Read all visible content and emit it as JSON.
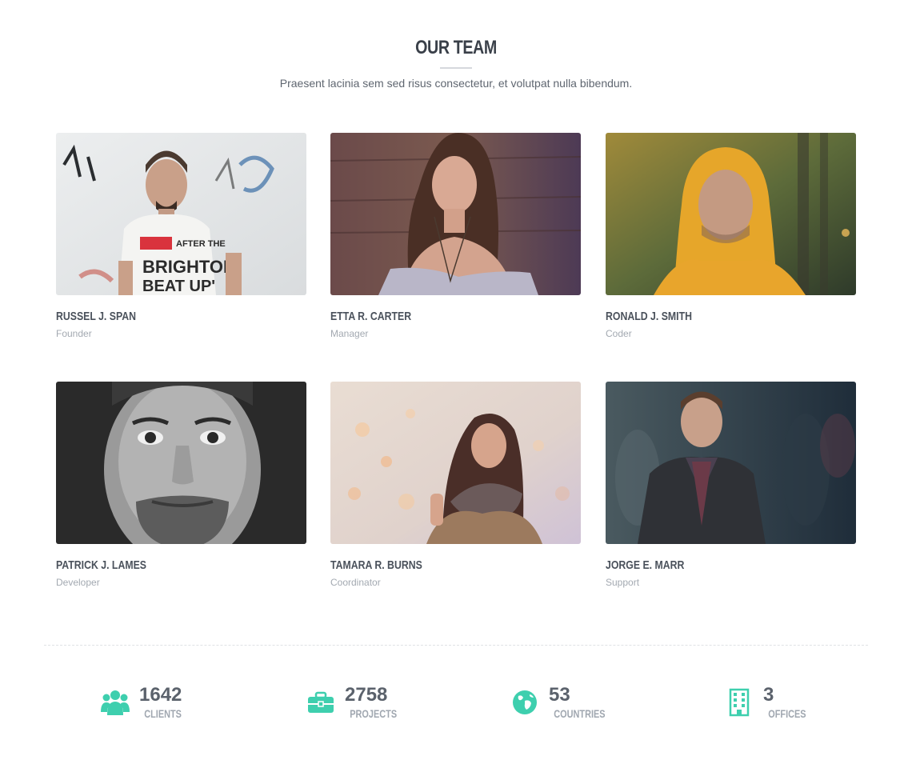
{
  "section": {
    "title": "OUR TEAM",
    "subtitle": "Praesent lacinia sem sed risus consectetur, et volutpat nulla bibendum."
  },
  "team": [
    {
      "name": "RUSSEL J. SPAN",
      "role": "Founder"
    },
    {
      "name": "ETTA R. CARTER",
      "role": "Manager"
    },
    {
      "name": "RONALD J. SMITH",
      "role": "Coder"
    },
    {
      "name": "PATRICK J. LAMES",
      "role": "Developer"
    },
    {
      "name": "TAMARA R. BURNS",
      "role": "Coordinator"
    },
    {
      "name": "JORGE E. MARR",
      "role": "Support"
    }
  ],
  "stats": [
    {
      "value": "1642",
      "label": "CLIENTS",
      "icon": "users-icon"
    },
    {
      "value": "2758",
      "label": "PROJECTS",
      "icon": "briefcase-icon"
    },
    {
      "value": "53",
      "label": "COUNTRIES",
      "icon": "globe-icon"
    },
    {
      "value": "3",
      "label": "OFFICES",
      "icon": "building-icon"
    }
  ],
  "colors": {
    "accent": "#3ecfae",
    "heading": "#3a4049",
    "muted": "#a3a9b1"
  }
}
